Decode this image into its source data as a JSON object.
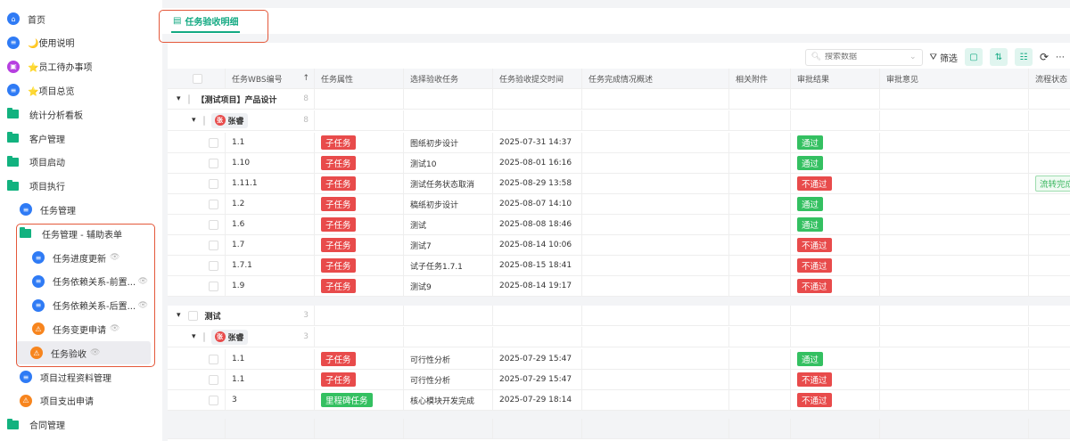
{
  "sidebar": {
    "items": [
      {
        "label": "首页",
        "icon": "home-icon",
        "color": "#2f7bf5"
      },
      {
        "label": "🌙使用说明",
        "icon": "document-icon",
        "color": "#2f7bf5"
      },
      {
        "label": "⭐员工待办事项",
        "icon": "board-icon",
        "color": "#b63fe0"
      },
      {
        "label": "⭐项目总览",
        "icon": "document-icon",
        "color": "#2f7bf5"
      },
      {
        "label": "统计分析看板",
        "icon": "folder-icon"
      },
      {
        "label": "客户管理",
        "icon": "folder-icon"
      },
      {
        "label": "项目启动",
        "icon": "folder-icon"
      },
      {
        "label": "项目执行",
        "icon": "folder-open-icon"
      },
      {
        "label": "任务管理",
        "icon": "document-icon",
        "color": "#2f7bf5"
      },
      {
        "label": "任务管理 - 辅助表单",
        "icon": "folder-open-icon"
      },
      {
        "label": "任务进度更新",
        "icon": "document-icon",
        "color": "#2f7bf5"
      },
      {
        "label": "任务依赖关系-前置...",
        "icon": "document-icon",
        "color": "#2f7bf5"
      },
      {
        "label": "任务依赖关系-后置...",
        "icon": "document-icon",
        "color": "#2f7bf5"
      },
      {
        "label": "任务变更申请",
        "icon": "form-icon",
        "color": "#f7851e"
      },
      {
        "label": "任务验收",
        "icon": "form-icon",
        "color": "#f7851e"
      },
      {
        "label": "项目过程资料管理",
        "icon": "document-icon",
        "color": "#2f7bf5"
      },
      {
        "label": "项目支出申请",
        "icon": "form-icon",
        "color": "#f7851e"
      },
      {
        "label": "合同管理",
        "icon": "folder-icon"
      }
    ]
  },
  "tab": {
    "label": "任务验收明细"
  },
  "toolbar": {
    "search_placeholder": "搜索数据",
    "filter_label": "筛选"
  },
  "columns": [
    "任务WBS编号",
    "任务属性",
    "选择验收任务",
    "任务验收提交时间",
    "任务完成情况概述",
    "相关附件",
    "审批结果",
    "审批意见",
    "流程状态"
  ],
  "groups": [
    {
      "name": "【测试项目】产品设计",
      "count": "8",
      "person": "张睿",
      "avatar": "张",
      "person_count": "8",
      "rows": [
        {
          "wbs": "1.1",
          "type": "子任务",
          "task": "图纸初步设计",
          "time": "2025-07-31 14:37",
          "result": "通过",
          "status": ""
        },
        {
          "wbs": "1.10",
          "type": "子任务",
          "task": "测试10",
          "time": "2025-08-01 16:16",
          "result": "通过",
          "status": ""
        },
        {
          "wbs": "1.11.1",
          "type": "子任务",
          "task": "测试任务状态取消",
          "time": "2025-08-29 13:58",
          "result": "不通过",
          "status": "流转完成"
        },
        {
          "wbs": "1.2",
          "type": "子任务",
          "task": "稿纸初步设计",
          "time": "2025-08-07 14:10",
          "result": "通过",
          "status": ""
        },
        {
          "wbs": "1.6",
          "type": "子任务",
          "task": "测试",
          "time": "2025-08-08 18:46",
          "result": "通过",
          "status": ""
        },
        {
          "wbs": "1.7",
          "type": "子任务",
          "task": "测试7",
          "time": "2025-08-14 10:06",
          "result": "不通过",
          "status": ""
        },
        {
          "wbs": "1.7.1",
          "type": "子任务",
          "task": "试子任务1.7.1",
          "time": "2025-08-15 18:41",
          "result": "不通过",
          "status": ""
        },
        {
          "wbs": "1.9",
          "type": "子任务",
          "task": "测试9",
          "time": "2025-08-14 19:17",
          "result": "不通过",
          "status": ""
        }
      ]
    },
    {
      "name": "测试",
      "count": "3",
      "person": "张睿",
      "avatar": "张",
      "person_count": "3",
      "rows": [
        {
          "wbs": "1.1",
          "type": "子任务",
          "task": "可行性分析",
          "time": "2025-07-29 15:47",
          "result": "通过",
          "status": ""
        },
        {
          "wbs": "1.1",
          "type": "子任务",
          "task": "可行性分析",
          "time": "2025-07-29 15:47",
          "result": "不通过",
          "status": ""
        },
        {
          "wbs": "3",
          "type": "里程碑任务",
          "task": "核心模块开发完成",
          "time": "2025-07-29 18:14",
          "result": "不通过",
          "status": ""
        }
      ]
    }
  ]
}
